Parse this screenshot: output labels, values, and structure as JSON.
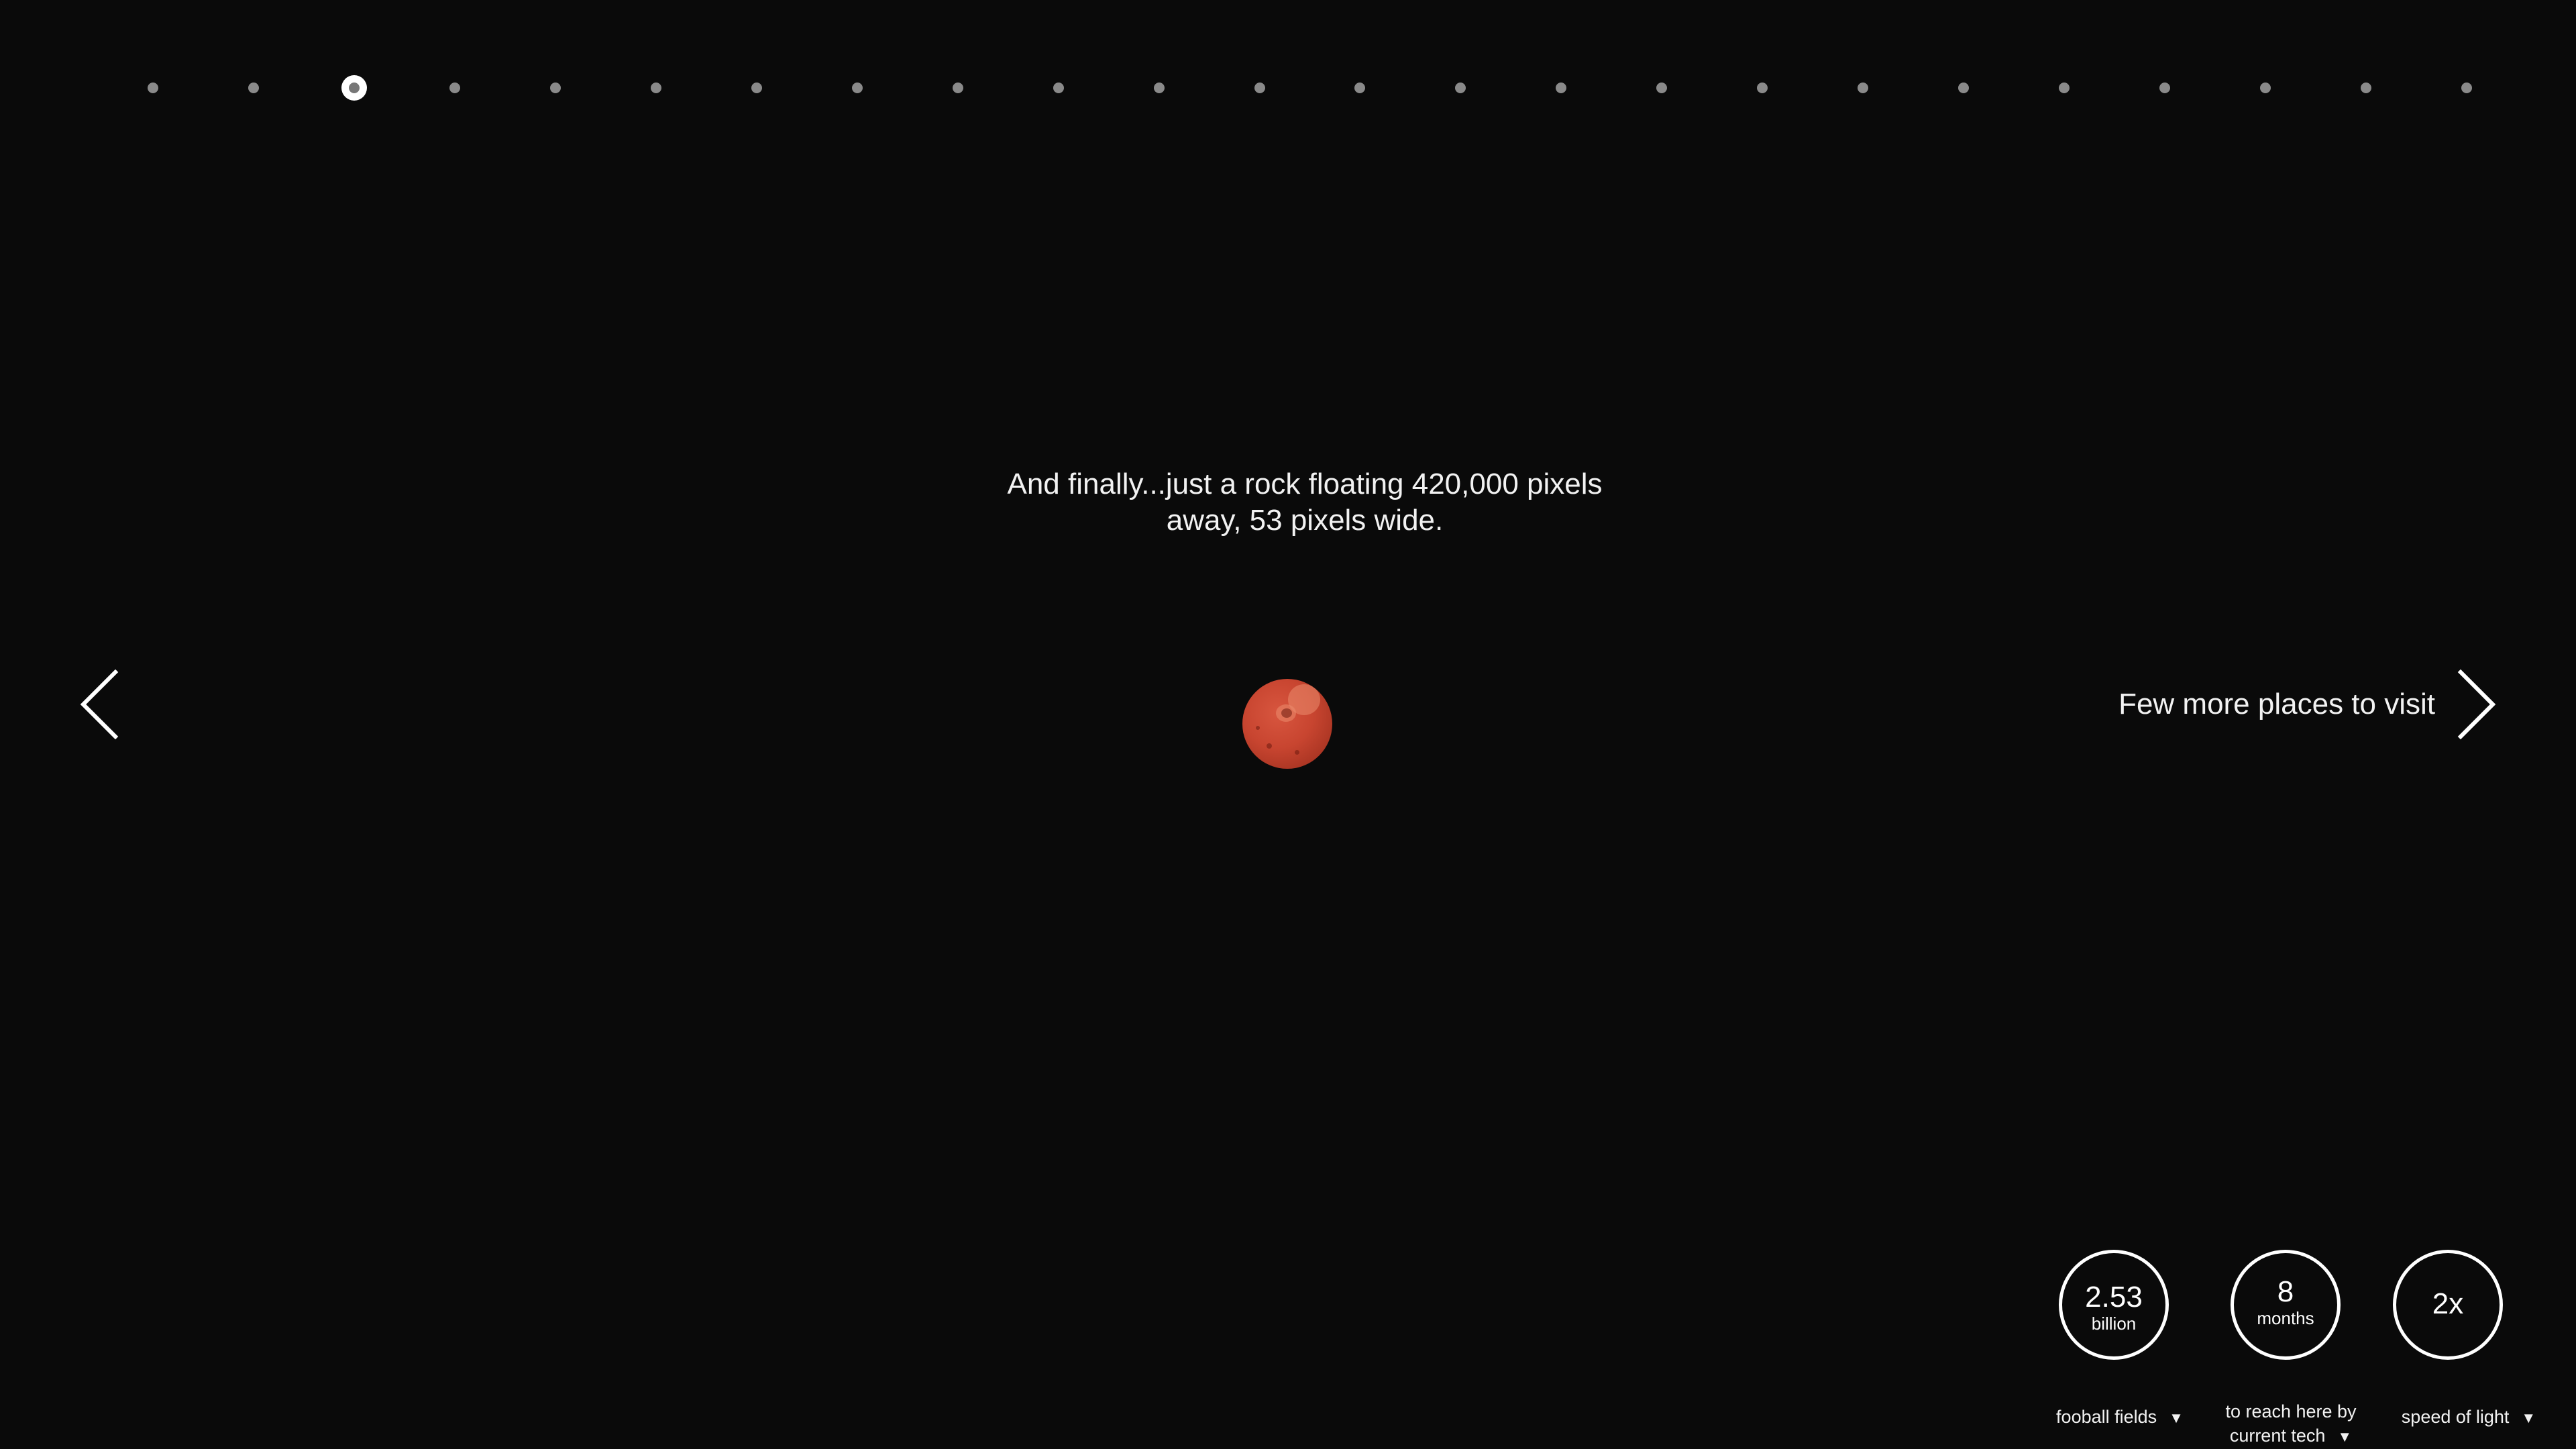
{
  "progress": {
    "total_steps": 24,
    "active_index": 2
  },
  "caption": "And finally...just a rock floating 420,000 pixels\naway, 53 pixels wide.",
  "navigation": {
    "prev_icon": "chevron-left-icon",
    "next_icon": "chevron-right-icon",
    "next_label": "Few more places to visit"
  },
  "planet": {
    "color": "#c84530"
  },
  "stats": [
    {
      "value": "2.53",
      "unit": "billion",
      "select_label": "fooball fields",
      "caret": "▼"
    },
    {
      "value": "8",
      "unit": "months",
      "select_label": "to reach here by\ncurrent tech",
      "caret": "▼"
    },
    {
      "value": "2x",
      "unit": "",
      "select_label": "speed of light",
      "caret": "▼"
    }
  ],
  "colors": {
    "background": "#0a0a0a",
    "foreground": "#ffffff",
    "dot_inactive": "#8a8a8a"
  }
}
